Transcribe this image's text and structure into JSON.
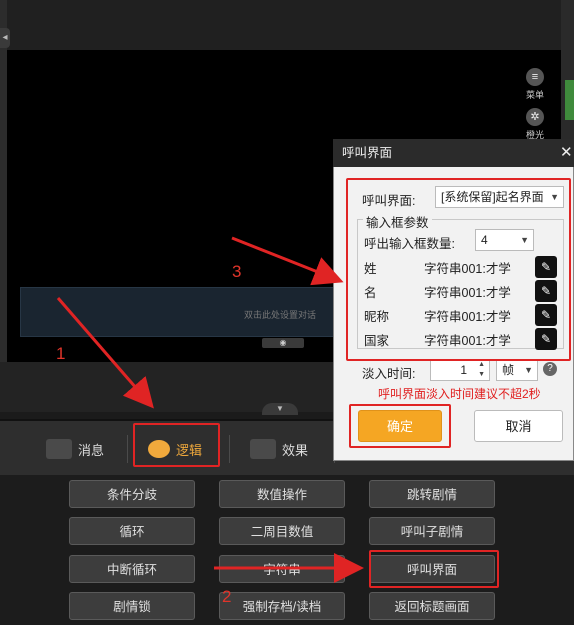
{
  "side_tools": [
    {
      "icon": "menu-icon",
      "label": "菜单"
    },
    {
      "icon": "fan-icon",
      "label": "橙光"
    }
  ],
  "scene": {
    "dialog_hint": "双击此处设置对话",
    "eye_icon": "eye-icon"
  },
  "tabs": [
    {
      "label": "消息",
      "icon": "message-icon"
    },
    {
      "label": "逻辑",
      "icon": "logic-icon"
    },
    {
      "label": "效果",
      "icon": "sparkle-icon"
    }
  ],
  "commands": [
    [
      "条件分歧",
      "数值操作",
      "跳转剧情"
    ],
    [
      "循环",
      "二周目数值",
      "呼叫子剧情"
    ],
    [
      "中断循环",
      "字符串",
      "呼叫界面"
    ],
    [
      "剧情锁",
      "强制存档/读档",
      "返回标题画面"
    ]
  ],
  "popup": {
    "title": "呼叫界面",
    "close": "✕",
    "screen_label": "呼叫界面:",
    "screen_value": "[系统保留]起名界面",
    "group_title": "输入框参数",
    "count_label": "呼出输入框数量:",
    "count_value": "4",
    "fields": [
      {
        "name": "姓",
        "value": "字符串001:才学"
      },
      {
        "name": "名",
        "value": "字符串001:才学"
      },
      {
        "name": "昵称",
        "value": "字符串001:才学"
      },
      {
        "name": "国家",
        "value": "字符串001:才学"
      }
    ],
    "fade_label": "淡入时间:",
    "fade_value": "1",
    "fade_unit": "帧",
    "help": "?",
    "warning": "呼叫界面淡入时间建议不超2秒",
    "ok": "确定",
    "cancel": "取消"
  },
  "annotations": {
    "n1": "1",
    "n2": "2",
    "n3": "3",
    "color": "#e02424"
  }
}
